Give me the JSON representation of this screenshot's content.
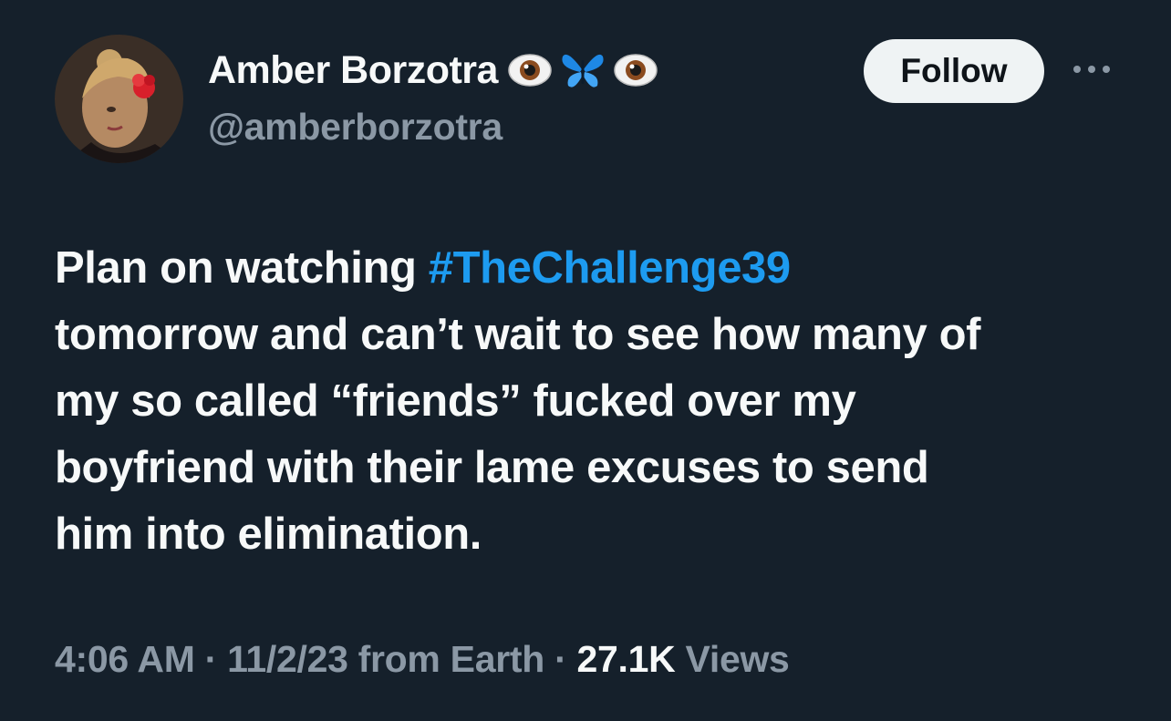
{
  "author": {
    "display_name": "Amber Borzotra",
    "handle": "@amberborzotra",
    "name_emojis": [
      "eyes-emoji",
      "butterfly-emoji",
      "eyes-emoji"
    ]
  },
  "actions": {
    "follow_label": "Follow",
    "more_icon": "more-dots-icon"
  },
  "tweet": {
    "text_line1_before": "Plan on watching ",
    "hashtag": "#TheChallenge39",
    "line2": "tomorrow and can’t wait to see how many of",
    "line3": "my so called “friends” fucked over my",
    "line4": "boyfriend with their lame excuses to send",
    "line5": "him into elimination."
  },
  "meta": {
    "time": "4:06 AM",
    "sep1": " · ",
    "date": "11/2/23",
    "source": " from Earth",
    "sep2": " · ",
    "views_count": "27.1K",
    "views_label": " Views"
  },
  "colors": {
    "background": "#15202b",
    "text_primary": "#f7f9f9",
    "text_secondary": "#8b98a5",
    "link": "#1d9bf0",
    "follow_bg": "#eff3f4"
  }
}
